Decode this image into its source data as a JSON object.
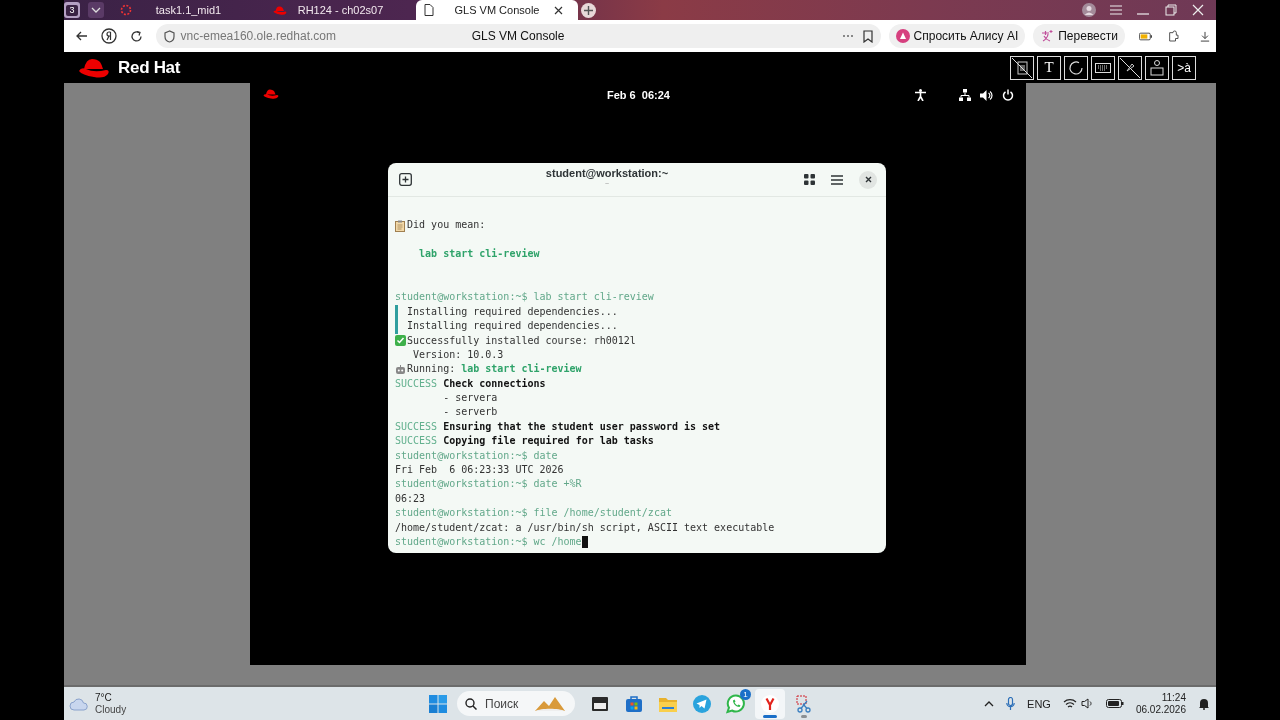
{
  "browser": {
    "tab_count": "3",
    "tabs": [
      {
        "title": "task1.1_mid1",
        "selected": false
      },
      {
        "title": "RH124 - ch02s07",
        "selected": false
      },
      {
        "title": "GLS VM Console",
        "selected": true
      }
    ],
    "url": "vnc-emea160.ole.redhat.com",
    "page_title": "GLS VM Console",
    "pills": [
      "Спросить Алису AI",
      "Перевести"
    ]
  },
  "vnc_header": {
    "brand": "Red Hat",
    "text_tool": "T",
    "layout_tool": ">à"
  },
  "desktop": {
    "clock": "Feb 6  06:24"
  },
  "terminal": {
    "title": "student@workstation:~",
    "subtitle": "~",
    "cursor_visible": true,
    "lines": [
      {
        "kind": "blank"
      },
      {
        "kind": "note",
        "text": "Did you mean:"
      },
      {
        "kind": "blank"
      },
      {
        "kind": "suggestion",
        "text": "lab start cli-review"
      },
      {
        "kind": "blank"
      },
      {
        "kind": "blank"
      },
      {
        "kind": "prompt",
        "prompt": "student@workstation:~$",
        "command": " lab start cli-review"
      },
      {
        "kind": "progress",
        "text": "Installing required dependencies..."
      },
      {
        "kind": "progress",
        "text": "Installing required dependencies..."
      },
      {
        "kind": "done",
        "text": "Successfully installed course: rh0012l"
      },
      {
        "kind": "detail",
        "text": "Version: 10.0.3"
      },
      {
        "kind": "running",
        "label": "Running: ",
        "command": "lab start cli-review"
      },
      {
        "kind": "success",
        "status": "SUCCESS",
        "message": " Check connections"
      },
      {
        "kind": "list-item",
        "text": "- servera"
      },
      {
        "kind": "list-item",
        "text": "- serverb"
      },
      {
        "kind": "success",
        "status": "SUCCESS",
        "message": " Ensuring that the student user password is set"
      },
      {
        "kind": "success",
        "status": "SUCCESS",
        "message": " Copying file required for lab tasks"
      },
      {
        "kind": "prompt",
        "prompt": "student@workstation:~$",
        "command": " date"
      },
      {
        "kind": "output",
        "text": "Fri Feb  6 06:23:33 UTC 2026"
      },
      {
        "kind": "prompt",
        "prompt": "student@workstation:~$",
        "command": " date +%R"
      },
      {
        "kind": "output",
        "text": "06:23"
      },
      {
        "kind": "prompt",
        "prompt": "student@workstation:~$",
        "command": " file /home/student/zcat"
      },
      {
        "kind": "output",
        "text": "/home/student/zcat: a /usr/bin/sh script, ASCII text executable"
      },
      {
        "kind": "prompt",
        "prompt": "student@workstation:~$",
        "command": " wc /home"
      }
    ]
  },
  "taskbar": {
    "temperature": "7°C",
    "condition": "Cloudy",
    "search": {
      "placeholder": "Поиск"
    },
    "apps": [
      {
        "selected": false,
        "running": false
      },
      {
        "selected": false,
        "running": false
      },
      {
        "selected": false,
        "running": false
      },
      {
        "selected": false,
        "running": false
      },
      {
        "selected": false,
        "running": false,
        "badge": "1"
      },
      {
        "selected": true,
        "running": true
      },
      {
        "selected": false,
        "running": true
      }
    ],
    "language": "ENG",
    "time": "11:24",
    "date": "06.02.2026"
  }
}
